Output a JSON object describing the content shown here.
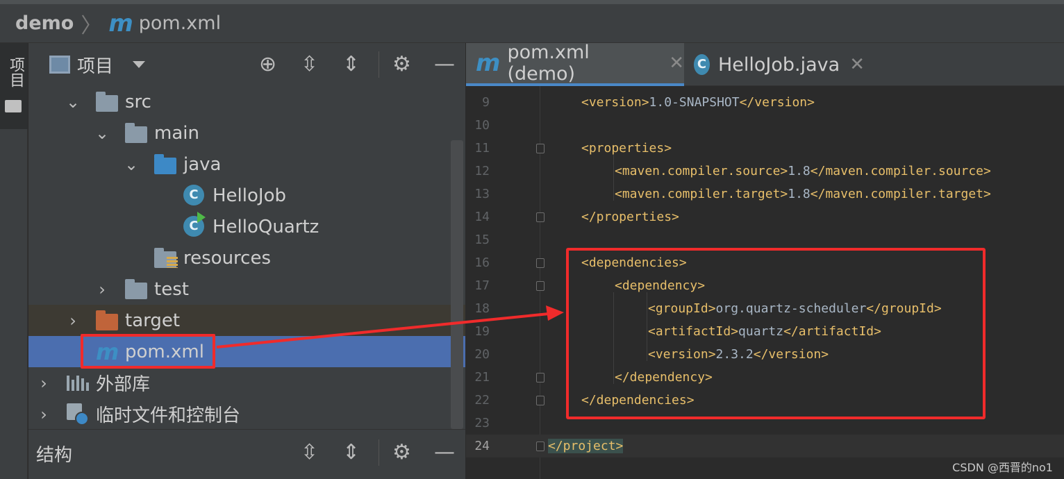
{
  "breadcrumb": {
    "project": "demo",
    "separator": "〉",
    "file_icon": "m",
    "file": "pom.xml"
  },
  "left_strip": {
    "label": "项目",
    "icon": "folder-icon"
  },
  "project_panel": {
    "title": "项目",
    "tools": [
      "locate-icon",
      "expand-all-icon",
      "collapse-all-icon",
      "gear-icon",
      "minimize-icon"
    ]
  },
  "tree": [
    {
      "label": "src",
      "icon": "folder-gray",
      "expanded": true
    },
    {
      "label": "main",
      "icon": "folder-gray",
      "expanded": true
    },
    {
      "label": "java",
      "icon": "folder-blue",
      "expanded": true
    },
    {
      "label": "HelloJob",
      "icon": "class-icon"
    },
    {
      "label": "HelloQuartz",
      "icon": "runnable-class-icon"
    },
    {
      "label": "resources",
      "icon": "resources-folder"
    },
    {
      "label": "test",
      "icon": "folder-gray",
      "expanded": false
    },
    {
      "label": "target",
      "icon": "folder-orange",
      "expanded": false
    },
    {
      "label": "pom.xml",
      "icon": "maven-icon",
      "selected": true
    },
    {
      "label": "外部库",
      "icon": "library-icon",
      "expanded": false
    },
    {
      "label": "临时文件和控制台",
      "icon": "scratch-icon",
      "expanded": false
    }
  ],
  "structure_panel": {
    "title": "结构"
  },
  "tabs": [
    {
      "label": "pom.xml (demo)",
      "icon": "m",
      "close": "✕",
      "active": true
    },
    {
      "label": "HelloJob.java",
      "icon": "C",
      "close": "✕",
      "active": false
    }
  ],
  "editor": {
    "lines": [
      {
        "n": "9",
        "text": "<version>1.0-SNAPSHOT</version>"
      },
      {
        "n": "10",
        "text": ""
      },
      {
        "n": "11",
        "text": "<properties>"
      },
      {
        "n": "12",
        "text": "<maven.compiler.source>1.8</maven.compiler.source>"
      },
      {
        "n": "13",
        "text": "<maven.compiler.target>1.8</maven.compiler.target>"
      },
      {
        "n": "14",
        "text": "</properties>"
      },
      {
        "n": "15",
        "text": ""
      },
      {
        "n": "16",
        "text": "<dependencies>"
      },
      {
        "n": "17",
        "text": "<dependency>"
      },
      {
        "n": "18",
        "text": "<groupId>org.quartz-scheduler</groupId>"
      },
      {
        "n": "19",
        "text": "<artifactId>quartz</artifactId>"
      },
      {
        "n": "20",
        "text": "<version>2.3.2</version>"
      },
      {
        "n": "21",
        "text": "</dependency>"
      },
      {
        "n": "22",
        "text": "</dependencies>"
      },
      {
        "n": "23",
        "text": ""
      },
      {
        "n": "24",
        "text": "</project>"
      }
    ],
    "current_line": "24"
  },
  "watermark": "CSDN @西晋的no1",
  "colors": {
    "highlight": "#f02b2b",
    "selection": "#4b6eaf",
    "tag": "#e8bf6a",
    "text": "#a9b7c6"
  }
}
